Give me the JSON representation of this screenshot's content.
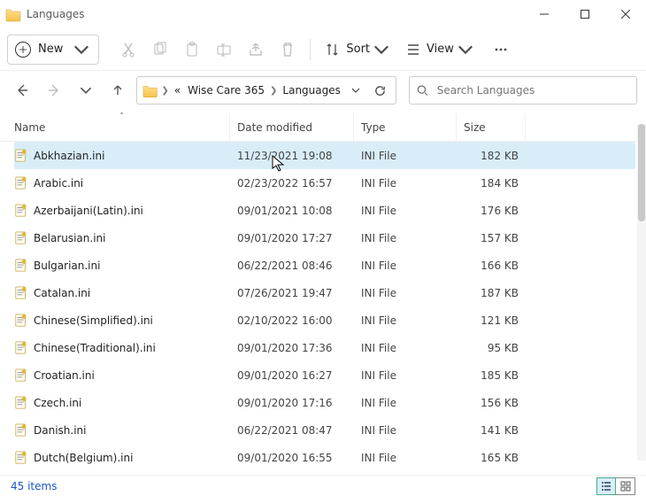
{
  "window": {
    "title": "Languages"
  },
  "toolbar": {
    "new_label": "New",
    "sort_label": "Sort",
    "view_label": "View"
  },
  "breadcrumb": {
    "segments": [
      "Wise Care 365",
      "Languages"
    ]
  },
  "search": {
    "placeholder": "Search Languages"
  },
  "columns": {
    "name": "Name",
    "date": "Date modified",
    "type": "Type",
    "size": "Size"
  },
  "files": [
    {
      "name": "Abkhazian.ini",
      "date": "11/23/2021 19:08",
      "type": "INI File",
      "size": "182 KB",
      "selected": true
    },
    {
      "name": "Arabic.ini",
      "date": "02/23/2022 16:57",
      "type": "INI File",
      "size": "184 KB"
    },
    {
      "name": "Azerbaijani(Latin).ini",
      "date": "09/01/2021 10:08",
      "type": "INI File",
      "size": "176 KB"
    },
    {
      "name": "Belarusian.ini",
      "date": "09/01/2020 17:27",
      "type": "INI File",
      "size": "157 KB"
    },
    {
      "name": "Bulgarian.ini",
      "date": "06/22/2021 08:46",
      "type": "INI File",
      "size": "166 KB"
    },
    {
      "name": "Catalan.ini",
      "date": "07/26/2021 19:47",
      "type": "INI File",
      "size": "187 KB"
    },
    {
      "name": "Chinese(Simplified).ini",
      "date": "02/10/2022 16:00",
      "type": "INI File",
      "size": "121 KB"
    },
    {
      "name": "Chinese(Traditional).ini",
      "date": "09/01/2020 17:36",
      "type": "INI File",
      "size": "95 KB"
    },
    {
      "name": "Croatian.ini",
      "date": "09/01/2020 16:27",
      "type": "INI File",
      "size": "185 KB"
    },
    {
      "name": "Czech.ini",
      "date": "09/01/2020 17:16",
      "type": "INI File",
      "size": "156 KB"
    },
    {
      "name": "Danish.ini",
      "date": "06/22/2021 08:47",
      "type": "INI File",
      "size": "141 KB"
    },
    {
      "name": "Dutch(Belgium).ini",
      "date": "09/01/2020 16:55",
      "type": "INI File",
      "size": "165 KB"
    }
  ],
  "status": {
    "count_label": "45 items"
  }
}
